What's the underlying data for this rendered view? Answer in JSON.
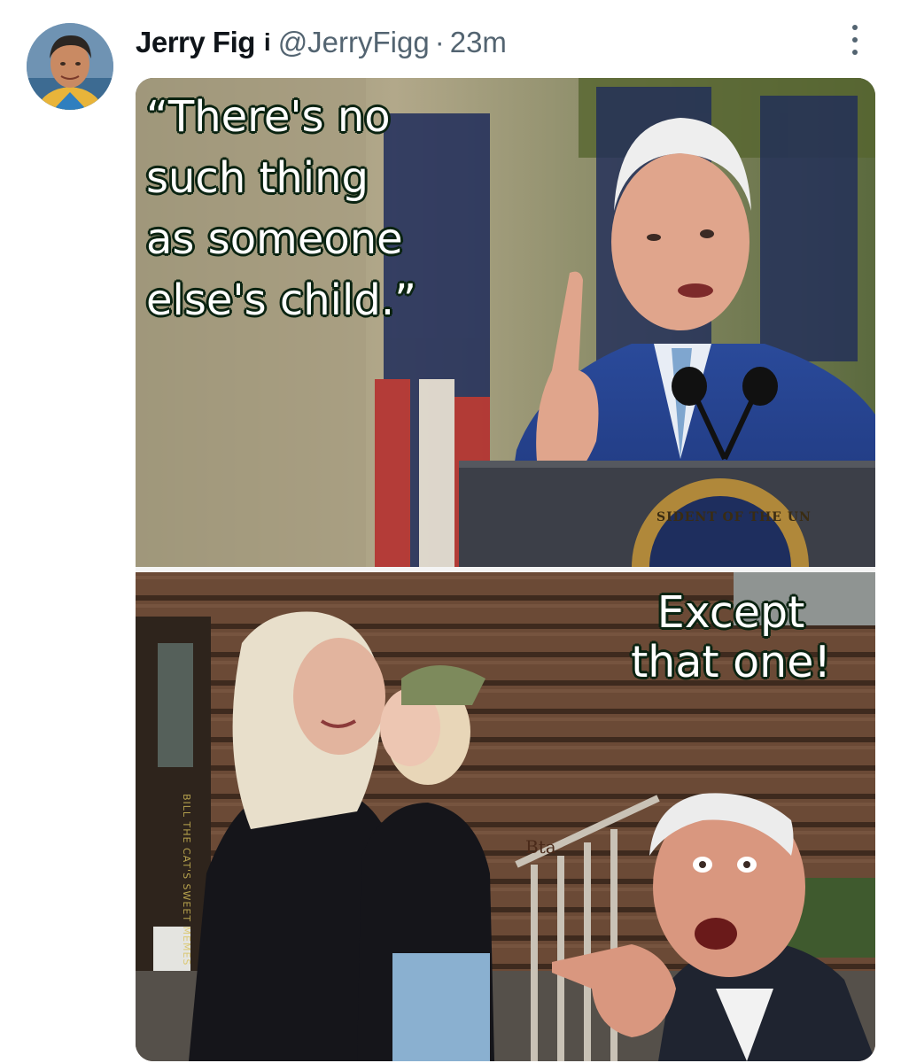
{
  "tweet": {
    "display_name": "Jerry Fig",
    "badge": "i",
    "handle": "@JerryFigg",
    "separator": "·",
    "time": "23m",
    "more_icon": "more-vertical-icon"
  },
  "meme": {
    "top": {
      "quote_lines": [
        "“There's no",
        "such thing",
        "as someone",
        "else's child.”"
      ],
      "seal_text": "SIDENT OF THE UN"
    },
    "bottom": {
      "caption_lines": [
        "Except",
        "that one!"
      ],
      "watermark": "BILL THE CAT'S SWEET MEMES",
      "sign_text": "Bta"
    }
  },
  "colors": {
    "handle_gray": "#536471",
    "text_dark": "#0f1419",
    "meme_outline": "#0b2412"
  }
}
